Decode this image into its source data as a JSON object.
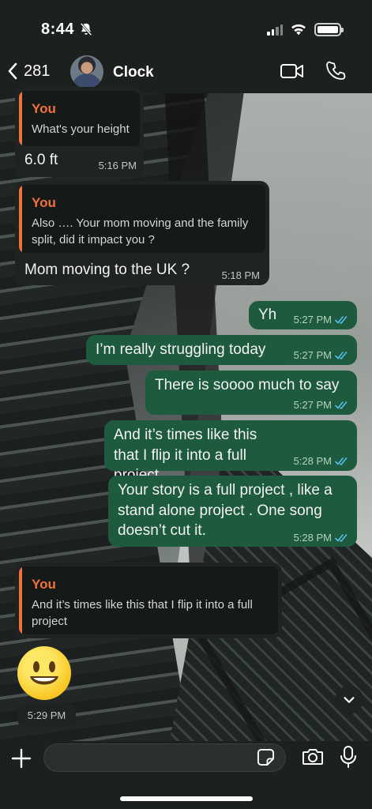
{
  "status_bar": {
    "time": "8:44"
  },
  "header": {
    "back_count": "281",
    "contact_name": "Clock"
  },
  "messages": [
    {
      "reply_name": "You",
      "reply_text": "What's your height",
      "text": "6.0 ft",
      "time": "5:16 PM"
    },
    {
      "reply_name": "You",
      "reply_text": "Also …. Your mom moving and the family split, did it impact you ?",
      "text": "Mom moving to the UK ?",
      "time": "5:18 PM"
    },
    {
      "text": "Yh",
      "time": "5:27 PM"
    },
    {
      "text": "I’m really struggling today",
      "time": "5:27 PM"
    },
    {
      "text": "There is soooo much to say",
      "time": "5:27 PM"
    },
    {
      "text": "And it’s times like this that I flip it into a full project",
      "time": "5:28 PM"
    },
    {
      "text": "Your story is a full project , like a stand alone project . One song doesn’t cut it.",
      "time": "5:28 PM"
    },
    {
      "reply_name": "You",
      "reply_text": "And it’s times like this that I flip it into a full project"
    },
    {
      "time": "5:29 PM"
    }
  ],
  "composer": {
    "placeholder": ""
  },
  "colors": {
    "incoming_bubble": "#1f2322",
    "outgoing_bubble": "#1e5a3e",
    "reply_accent": "#f0723a",
    "read_ticks": "#53bdeb"
  }
}
